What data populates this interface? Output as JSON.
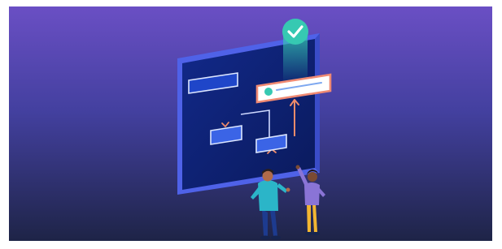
{
  "illustration": {
    "colors": {
      "background_top": "#6a4fc4",
      "background_mid": "#3d3a9e",
      "background_bottom": "#1e2447",
      "board_frame": "#5a6df0",
      "board_inner": "#0b1f6b",
      "card_fill": "#3b64e6",
      "card_outline": "#dce6ff",
      "highlight_card_border": "#f08a73",
      "accent_teal": "#36c9b2",
      "connector_orange": "#ef8b6a",
      "person_left_shirt": "#2bb5c8",
      "person_right_shirt": "#8a74d6",
      "person_right_pants": "#f2b632"
    },
    "icons": [
      "check-badge-icon",
      "board-illustration",
      "person-left-figure",
      "person-right-figure"
    ]
  }
}
